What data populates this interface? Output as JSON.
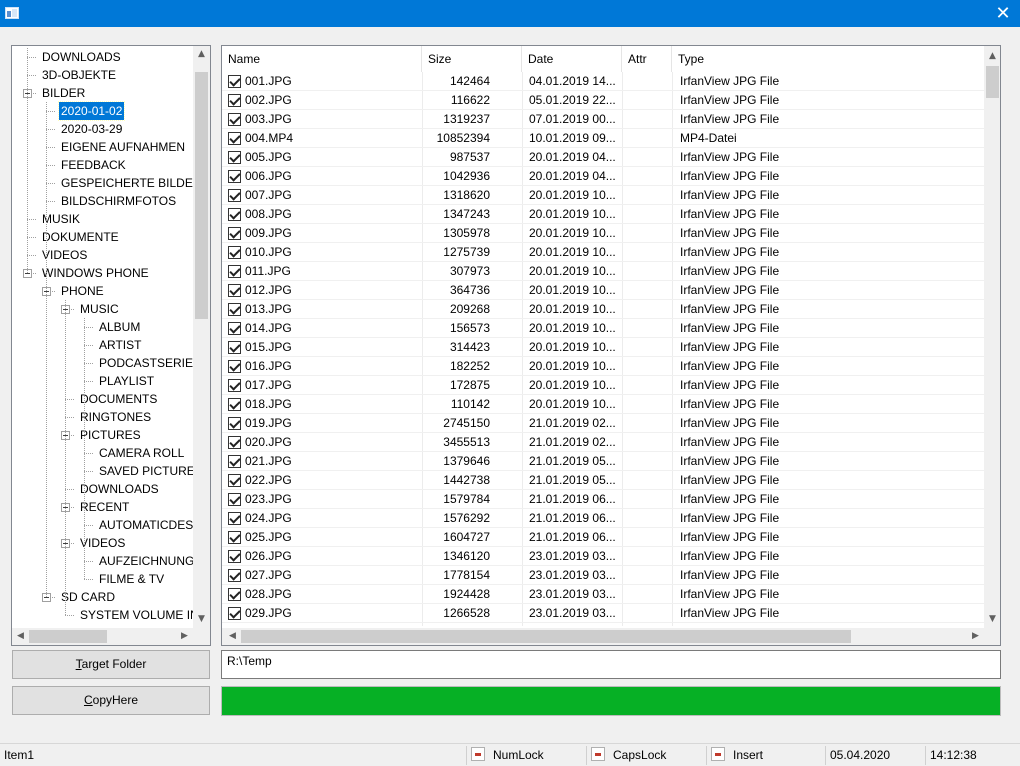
{
  "window": {
    "close_glyph": "✕"
  },
  "tree": {
    "items": [
      {
        "label": "DOWNLOADS",
        "level": 0,
        "expander": false
      },
      {
        "label": "3D-OBJEKTE",
        "level": 0,
        "expander": false
      },
      {
        "label": "BILDER",
        "level": 0,
        "expander": true
      },
      {
        "label": "2020-01-02",
        "level": 1,
        "expander": false,
        "selected": true
      },
      {
        "label": "2020-03-29",
        "level": 1,
        "expander": false
      },
      {
        "label": "EIGENE AUFNAHMEN",
        "level": 1,
        "expander": false
      },
      {
        "label": "FEEDBACK",
        "level": 1,
        "expander": false
      },
      {
        "label": "GESPEICHERTE BILDER",
        "level": 1,
        "expander": false
      },
      {
        "label": "BILDSCHIRMFOTOS",
        "level": 1,
        "expander": false
      },
      {
        "label": "MUSIK",
        "level": 0,
        "expander": false
      },
      {
        "label": "DOKUMENTE",
        "level": 0,
        "expander": false
      },
      {
        "label": "VIDEOS",
        "level": 0,
        "expander": false
      },
      {
        "label": "WINDOWS PHONE",
        "level": 0,
        "expander": true
      },
      {
        "label": "PHONE",
        "level": 1,
        "expander": true
      },
      {
        "label": "MUSIC",
        "level": 2,
        "expander": true
      },
      {
        "label": "ALBUM",
        "level": 3,
        "expander": false
      },
      {
        "label": "ARTIST",
        "level": 3,
        "expander": false
      },
      {
        "label": "PODCASTSERIES",
        "level": 3,
        "expander": false
      },
      {
        "label": "PLAYLIST",
        "level": 3,
        "expander": false
      },
      {
        "label": "DOCUMENTS",
        "level": 2,
        "expander": false
      },
      {
        "label": "RINGTONES",
        "level": 2,
        "expander": false
      },
      {
        "label": "PICTURES",
        "level": 2,
        "expander": true
      },
      {
        "label": "CAMERA ROLL",
        "level": 3,
        "expander": false
      },
      {
        "label": "SAVED PICTURES",
        "level": 3,
        "expander": false
      },
      {
        "label": "DOWNLOADS",
        "level": 2,
        "expander": false
      },
      {
        "label": "RECENT",
        "level": 2,
        "expander": true
      },
      {
        "label": "AUTOMATICDESTINATIONS",
        "level": 3,
        "expander": false
      },
      {
        "label": "VIDEOS",
        "level": 2,
        "expander": true
      },
      {
        "label": "AUFZEICHNUNGEN",
        "level": 3,
        "expander": false
      },
      {
        "label": "FILME & TV",
        "level": 3,
        "expander": false
      },
      {
        "label": "SD CARD",
        "level": 1,
        "expander": true
      },
      {
        "label": "SYSTEM VOLUME INFORMATION",
        "level": 2,
        "expander": false
      }
    ]
  },
  "list": {
    "columns": [
      "Name",
      "Size",
      "Date",
      "Attr",
      "Type"
    ],
    "rows": [
      {
        "name": "001.JPG",
        "size": "142464",
        "date": "04.01.2019 14...",
        "attr": "",
        "type": "IrfanView JPG File"
      },
      {
        "name": "002.JPG",
        "size": "116622",
        "date": "05.01.2019 22...",
        "attr": "",
        "type": "IrfanView JPG File"
      },
      {
        "name": "003.JPG",
        "size": "1319237",
        "date": "07.01.2019 00...",
        "attr": "",
        "type": "IrfanView JPG File"
      },
      {
        "name": "004.MP4",
        "size": "10852394",
        "date": "10.01.2019 09...",
        "attr": "",
        "type": "MP4-Datei"
      },
      {
        "name": "005.JPG",
        "size": "987537",
        "date": "20.01.2019 04...",
        "attr": "",
        "type": "IrfanView JPG File"
      },
      {
        "name": "006.JPG",
        "size": "1042936",
        "date": "20.01.2019 04...",
        "attr": "",
        "type": "IrfanView JPG File"
      },
      {
        "name": "007.JPG",
        "size": "1318620",
        "date": "20.01.2019 10...",
        "attr": "",
        "type": "IrfanView JPG File"
      },
      {
        "name": "008.JPG",
        "size": "1347243",
        "date": "20.01.2019 10...",
        "attr": "",
        "type": "IrfanView JPG File"
      },
      {
        "name": "009.JPG",
        "size": "1305978",
        "date": "20.01.2019 10...",
        "attr": "",
        "type": "IrfanView JPG File"
      },
      {
        "name": "010.JPG",
        "size": "1275739",
        "date": "20.01.2019 10...",
        "attr": "",
        "type": "IrfanView JPG File"
      },
      {
        "name": "011.JPG",
        "size": "307973",
        "date": "20.01.2019 10...",
        "attr": "",
        "type": "IrfanView JPG File"
      },
      {
        "name": "012.JPG",
        "size": "364736",
        "date": "20.01.2019 10...",
        "attr": "",
        "type": "IrfanView JPG File"
      },
      {
        "name": "013.JPG",
        "size": "209268",
        "date": "20.01.2019 10...",
        "attr": "",
        "type": "IrfanView JPG File"
      },
      {
        "name": "014.JPG",
        "size": "156573",
        "date": "20.01.2019 10...",
        "attr": "",
        "type": "IrfanView JPG File"
      },
      {
        "name": "015.JPG",
        "size": "314423",
        "date": "20.01.2019 10...",
        "attr": "",
        "type": "IrfanView JPG File"
      },
      {
        "name": "016.JPG",
        "size": "182252",
        "date": "20.01.2019 10...",
        "attr": "",
        "type": "IrfanView JPG File"
      },
      {
        "name": "017.JPG",
        "size": "172875",
        "date": "20.01.2019 10...",
        "attr": "",
        "type": "IrfanView JPG File"
      },
      {
        "name": "018.JPG",
        "size": "110142",
        "date": "20.01.2019 10...",
        "attr": "",
        "type": "IrfanView JPG File"
      },
      {
        "name": "019.JPG",
        "size": "2745150",
        "date": "21.01.2019 02...",
        "attr": "",
        "type": "IrfanView JPG File"
      },
      {
        "name": "020.JPG",
        "size": "3455513",
        "date": "21.01.2019 02...",
        "attr": "",
        "type": "IrfanView JPG File"
      },
      {
        "name": "021.JPG",
        "size": "1379646",
        "date": "21.01.2019 05...",
        "attr": "",
        "type": "IrfanView JPG File"
      },
      {
        "name": "022.JPG",
        "size": "1442738",
        "date": "21.01.2019 05...",
        "attr": "",
        "type": "IrfanView JPG File"
      },
      {
        "name": "023.JPG",
        "size": "1579784",
        "date": "21.01.2019 06...",
        "attr": "",
        "type": "IrfanView JPG File"
      },
      {
        "name": "024.JPG",
        "size": "1576292",
        "date": "21.01.2019 06...",
        "attr": "",
        "type": "IrfanView JPG File"
      },
      {
        "name": "025.JPG",
        "size": "1604727",
        "date": "21.01.2019 06...",
        "attr": "",
        "type": "IrfanView JPG File"
      },
      {
        "name": "026.JPG",
        "size": "1346120",
        "date": "23.01.2019 03...",
        "attr": "",
        "type": "IrfanView JPG File"
      },
      {
        "name": "027.JPG",
        "size": "1778154",
        "date": "23.01.2019 03...",
        "attr": "",
        "type": "IrfanView JPG File"
      },
      {
        "name": "028.JPG",
        "size": "1924428",
        "date": "23.01.2019 03...",
        "attr": "",
        "type": "IrfanView JPG File"
      },
      {
        "name": "029.JPG",
        "size": "1266528",
        "date": "23.01.2019 03...",
        "attr": "",
        "type": "IrfanView JPG File"
      }
    ]
  },
  "buttons": {
    "target_folder": {
      "mnemonic": "T",
      "rest": "arget Folder"
    },
    "copy_here": {
      "mnemonic": "C",
      "rest": "opyHere"
    }
  },
  "target_path": "R:\\Temp",
  "progress": {
    "fraction": 1.0,
    "color": "#06b025"
  },
  "statusbar": {
    "item": "Item1",
    "numlock": "NumLock",
    "capslock": "CapsLock",
    "insert": "Insert",
    "date": "05.04.2020",
    "time": "14:12:38"
  },
  "colors": {
    "accent": "#0078d7",
    "selection": "#0078d7"
  }
}
